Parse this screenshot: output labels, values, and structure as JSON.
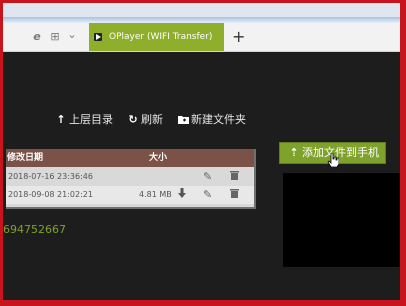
{
  "browser": {
    "tab_title": "OPlayer (WIFI Transfer)",
    "new_tab_label": "+",
    "edge_icon": "e",
    "grid_icon": "⊞",
    "chevron_icon": "⌄"
  },
  "toolbar": {
    "parent_dir_label": "上层目录",
    "refresh_label": "刷新",
    "new_folder_label": "新建文件夹"
  },
  "file_table": {
    "columns": {
      "date": "修改日期",
      "size": "大小"
    },
    "rows": [
      {
        "date": "2018-07-16 23:36:46",
        "size": ""
      },
      {
        "date": "2018-09-08 21:02:21",
        "size": "4.81 MB"
      }
    ]
  },
  "address_text": "694752667",
  "add_files_button_label": "添加文件到手机",
  "colors": {
    "accent_green": "#7fa22b",
    "table_header": "#7b5247",
    "background": "#1d1d1d"
  }
}
